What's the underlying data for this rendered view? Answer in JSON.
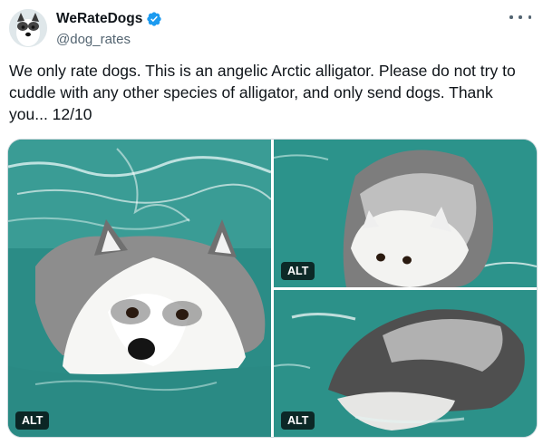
{
  "author": {
    "display_name": "WeRateDogs",
    "handle": "@dog_rates",
    "verified": true
  },
  "icons": {
    "avatar": "avatar-dog-icon",
    "verified": "verified-badge-icon",
    "more": "more-options-icon"
  },
  "colors": {
    "verified_blue": "#1d9bf0",
    "water": "#2a8f87",
    "text": "#0f1419",
    "secondary": "#536471"
  },
  "tweet": {
    "text": "We only rate dogs. This is an angelic Arctic alligator. Please do not try to cuddle with any other species of alligator, and only send dogs. Thank you... 12/10"
  },
  "media": {
    "alt_badges": [
      "ALT",
      "ALT",
      "ALT"
    ]
  }
}
